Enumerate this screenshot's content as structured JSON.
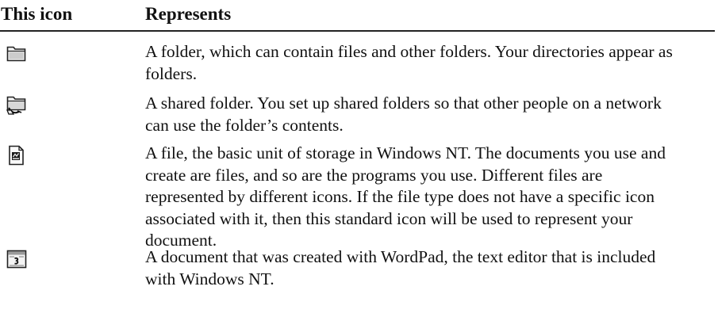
{
  "table": {
    "headers": {
      "icon_col": "This icon",
      "description_col": "Represents"
    },
    "rows": [
      {
        "icon": "folder-icon",
        "description": "A folder, which can contain files and other folders. Your directories appear as folders."
      },
      {
        "icon": "shared-folder-icon",
        "description": "A shared folder. You set up shared folders so that other people on a network can use the folder’s contents."
      },
      {
        "icon": "file-icon",
        "description": "A file, the basic unit of storage in Windows NT. The documents you use and create are files, and so are the programs you use. Different files are represented by different icons. If the file type does not have a specific icon associated with it, then this standard icon will be used to represent your document."
      },
      {
        "icon": "wordpad-document-icon",
        "description": "A document that was created with WordPad, the text editor that is included with Windows NT."
      }
    ]
  }
}
